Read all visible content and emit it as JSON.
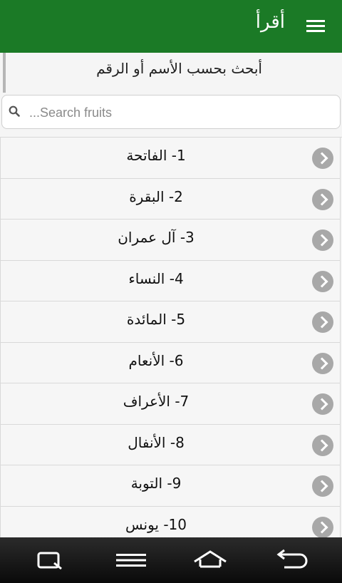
{
  "header": {
    "title": "أقرأ",
    "menu_icon": "hamburger-menu-icon",
    "background": "#1b7a26"
  },
  "hint": {
    "text": "أبحث بحسب الأسم أو الرقم"
  },
  "search": {
    "placeholder": "...Search fruits",
    "value": "",
    "icon": "search-icon"
  },
  "surahs": [
    {
      "label": "1- الفاتحة"
    },
    {
      "label": "2- البقرة"
    },
    {
      "label": "3- آل عمران"
    },
    {
      "label": "4- النساء"
    },
    {
      "label": "5- المائدة"
    },
    {
      "label": "6- الأنعام"
    },
    {
      "label": "7- الأعراف"
    },
    {
      "label": "8- الأنفال"
    },
    {
      "label": "9- التوبة"
    },
    {
      "label": "10- يونس"
    }
  ],
  "system_nav": {
    "buttons": [
      "recent-apps-icon",
      "menu-icon",
      "home-icon",
      "back-icon"
    ]
  }
}
